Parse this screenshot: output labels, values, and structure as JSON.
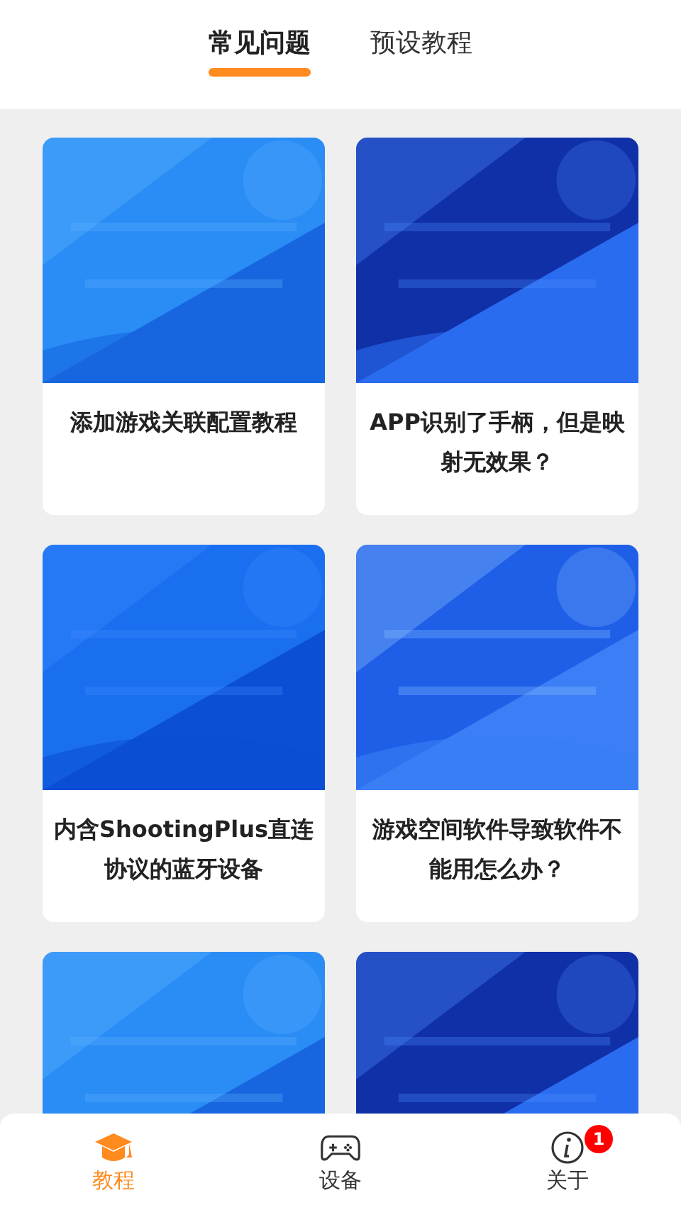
{
  "tabs": [
    {
      "label": "常见问题",
      "selected": true
    },
    {
      "label": "预设教程",
      "selected": false
    }
  ],
  "articles": [
    {
      "kind": "picture",
      "title": "添加游戏关联配置教程"
    },
    {
      "kind": "picture",
      "title": "APP识别了手柄，但是映射无效果？"
    },
    {
      "kind": "picture",
      "title": "内含ShootingPlus直连协议的蓝牙设备"
    },
    {
      "kind": "picture",
      "title": "游戏空间软件导致软件不能用怎么办？"
    },
    {
      "kind": "picture"
    },
    {
      "kind": "picture"
    }
  ],
  "bottom_nav": [
    {
      "label": "教程",
      "kind": "cap",
      "selected": true
    },
    {
      "label": "设备",
      "kind": "gamepad",
      "selected": false
    },
    {
      "label": "关于",
      "kind": "info",
      "selected": false,
      "badge": "1"
    }
  ]
}
